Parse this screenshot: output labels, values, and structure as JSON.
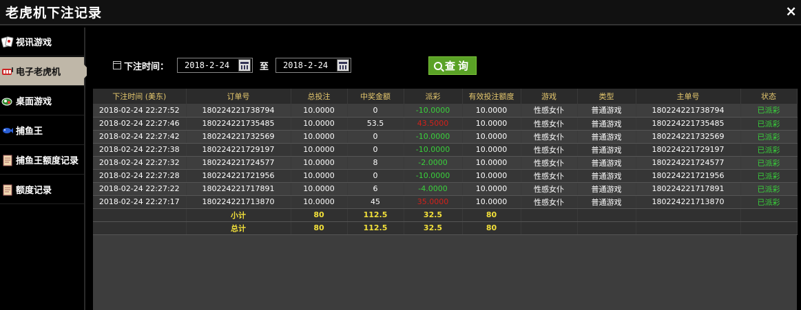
{
  "window": {
    "title": "老虎机下注记录",
    "close_glyph": "×"
  },
  "sidebar": {
    "items": [
      {
        "label": "视讯游戏",
        "icon": "cards-icon",
        "active": false
      },
      {
        "label": "电子老虎机",
        "icon": "slot-machine-icon",
        "active": true
      },
      {
        "label": "桌面游戏",
        "icon": "chips-icon",
        "active": false
      },
      {
        "label": "捕鱼王",
        "icon": "fish-icon",
        "active": false
      },
      {
        "label": "捕鱼王额度记录",
        "icon": "document-icon",
        "active": false
      },
      {
        "label": "额度记录",
        "icon": "document-icon",
        "active": false
      }
    ]
  },
  "filter": {
    "label": "下注时间：",
    "from_date": "2018-2-24",
    "to_label": "至",
    "to_date": "2018-2-24",
    "search_label": "查询"
  },
  "table": {
    "headers": [
      "下注时间 (美东)",
      "订单号",
      "总投注",
      "中奖金额",
      "派彩",
      "有效投注额度",
      "游戏",
      "类型",
      "主单号",
      "状态"
    ],
    "rows": [
      [
        "2018-02-24 22:27:52",
        "180224221738794",
        "10.0000",
        "0",
        "-10.0000",
        "10.0000",
        "性感女仆",
        "普通游戏",
        "180224221738794",
        "已派彩"
      ],
      [
        "2018-02-24 22:27:46",
        "180224221735485",
        "10.0000",
        "53.5",
        "43.5000",
        "10.0000",
        "性感女仆",
        "普通游戏",
        "180224221735485",
        "已派彩"
      ],
      [
        "2018-02-24 22:27:42",
        "180224221732569",
        "10.0000",
        "0",
        "-10.0000",
        "10.0000",
        "性感女仆",
        "普通游戏",
        "180224221732569",
        "已派彩"
      ],
      [
        "2018-02-24 22:27:38",
        "180224221729197",
        "10.0000",
        "0",
        "-10.0000",
        "10.0000",
        "性感女仆",
        "普通游戏",
        "180224221729197",
        "已派彩"
      ],
      [
        "2018-02-24 22:27:32",
        "180224221724577",
        "10.0000",
        "8",
        "-2.0000",
        "10.0000",
        "性感女仆",
        "普通游戏",
        "180224221724577",
        "已派彩"
      ],
      [
        "2018-02-24 22:27:28",
        "180224221721956",
        "10.0000",
        "0",
        "-10.0000",
        "10.0000",
        "性感女仆",
        "普通游戏",
        "180224221721956",
        "已派彩"
      ],
      [
        "2018-02-24 22:27:22",
        "180224221717891",
        "10.0000",
        "6",
        "-4.0000",
        "10.0000",
        "性感女仆",
        "普通游戏",
        "180224221717891",
        "已派彩"
      ],
      [
        "2018-02-24 22:27:17",
        "180224221713870",
        "10.0000",
        "45",
        "35.0000",
        "10.0000",
        "性感女仆",
        "普通游戏",
        "180224221713870",
        "已派彩"
      ]
    ],
    "subtotal": {
      "label": "小计",
      "bet": "80",
      "win": "112.5",
      "payout": "32.5",
      "valid": "80"
    },
    "total": {
      "label": "总计",
      "bet": "80",
      "win": "112.5",
      "payout": "32.5",
      "valid": "80"
    }
  },
  "colors": {
    "negative": "#39d13b",
    "positive": "#d4201a",
    "accent": "#5aa226",
    "header_text": "#e6c86e",
    "sum_text": "#f2e03a"
  }
}
